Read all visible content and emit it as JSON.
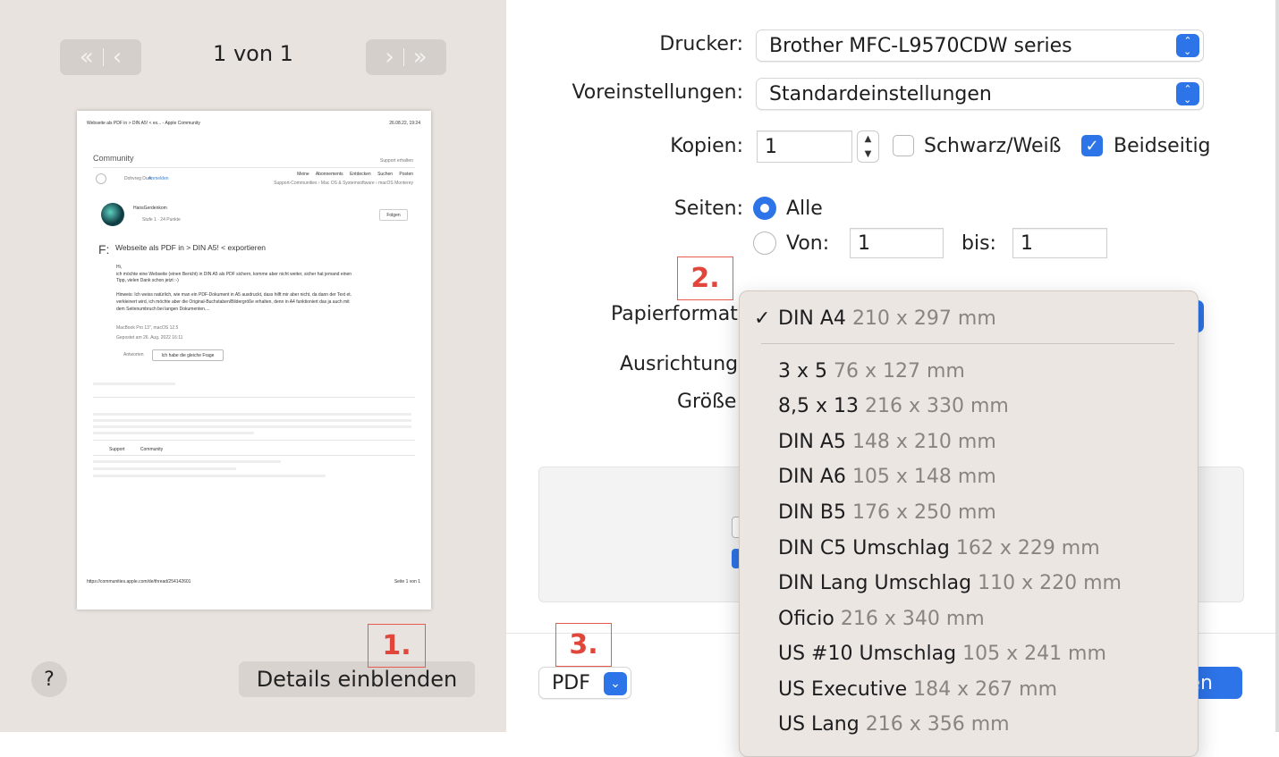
{
  "preview": {
    "nav_prev": "«|‹",
    "page_counter": "1 von 1",
    "nav_next": "›|»",
    "page": {
      "header_left": "Webseite als PDF in > DIN A5! < ex... - Apple Community",
      "header_right": "26.08.22, 19:24",
      "community": "Community",
      "support": "Support erhalten",
      "signin": "Anmelden",
      "nav_links": [
        "Meine Abonnements",
        "Entdecken",
        "Suchen",
        "Posten"
      ],
      "breadcrumb": "Support-Communities  ›  Mac OS & Systemsoftware  ›  macOS Monterey",
      "author": "HansGerdenkom",
      "follow": "Folgen",
      "question_title": "Webseite als PDF in > DIN A5! < exportieren",
      "body_1": "Hi,",
      "body_2": "ich möchte eine Webseite (einen Bericht) in DIN A5 als PDF sichern, komme aber nicht weiter, sicher hat jemand einen",
      "body_3": "Tipp, vielen Dank schon jetzt :-)",
      "body_4": "Hinweis: Ich weiss natürlich, wie man ein PDF-Dokument in A5 ausdruckt, dass hilft mir aber nicht, da dann der Text et.",
      "body_5": "verkleinert wird, ich möchte aber die Original-Buchstaben/Bildergröße erhalten, denn in A4 funktioniert das ja auch mit",
      "body_6": "dem Seitenumbruch bei langen Dokumenten....",
      "meta_device": "MacBook Pro 13\", macOS 12.5",
      "meta_date": "Gepostet am 26. Aug. 2022 16:11",
      "reply": "Antworten",
      "same_question": "Ich habe die gleiche Frage",
      "footer_url": "https://communities.apple.com/de/thread/254142601",
      "footer_page": "Seite 1 von 1"
    },
    "help": "?",
    "details_button": "Details einblenden"
  },
  "settings": {
    "printer_label": "Drucker:",
    "printer_value": "Brother MFC-L9570CDW series",
    "presets_label": "Voreinstellungen:",
    "presets_value": "Standardeinstellungen",
    "copies_label": "Kopien:",
    "copies_value": "1",
    "bw_label": "Schwarz/Weiß",
    "bw_checked": false,
    "duplex_label": "Beidseitig",
    "duplex_checked": true,
    "pages_label": "Seiten:",
    "pages_all": "Alle",
    "pages_from": "Von:",
    "pages_from_value": "1",
    "pages_to": "bis:",
    "pages_to_value": "1",
    "paper_label": "Papierformat",
    "orientation_label": "Ausrichtung",
    "size_label": "Größe",
    "pdf_button": "PDF",
    "print_button_partial": "en"
  },
  "annotations": [
    "1.",
    "2.",
    "3."
  ],
  "paper_menu": {
    "checkmark": "✓",
    "items": [
      {
        "name": "DIN A4",
        "dims": "210 x 297 mm",
        "selected": true
      },
      {
        "name": "3 x 5",
        "dims": "76 x 127 mm"
      },
      {
        "name": "8,5 x 13",
        "dims": "216 x 330 mm"
      },
      {
        "name": "DIN A5",
        "dims": "148 x 210 mm"
      },
      {
        "name": "DIN A6",
        "dims": "105 x 148 mm"
      },
      {
        "name": "DIN B5",
        "dims": "176 x 250 mm"
      },
      {
        "name": "DIN C5 Umschlag",
        "dims": "162 x 229 mm"
      },
      {
        "name": "DIN Lang Umschlag",
        "dims": "110 x 220 mm"
      },
      {
        "name": "Oficio",
        "dims": "216 x 340 mm"
      },
      {
        "name": "US #10 Umschlag",
        "dims": "105 x 241 mm"
      },
      {
        "name": "US Executive",
        "dims": "184 x 267 mm"
      },
      {
        "name": "US Lang",
        "dims": "216 x 356 mm"
      }
    ]
  },
  "colors": {
    "accent": "#2d74e8",
    "annotation": "#e0463a",
    "sidebar": "#e8e3df"
  }
}
